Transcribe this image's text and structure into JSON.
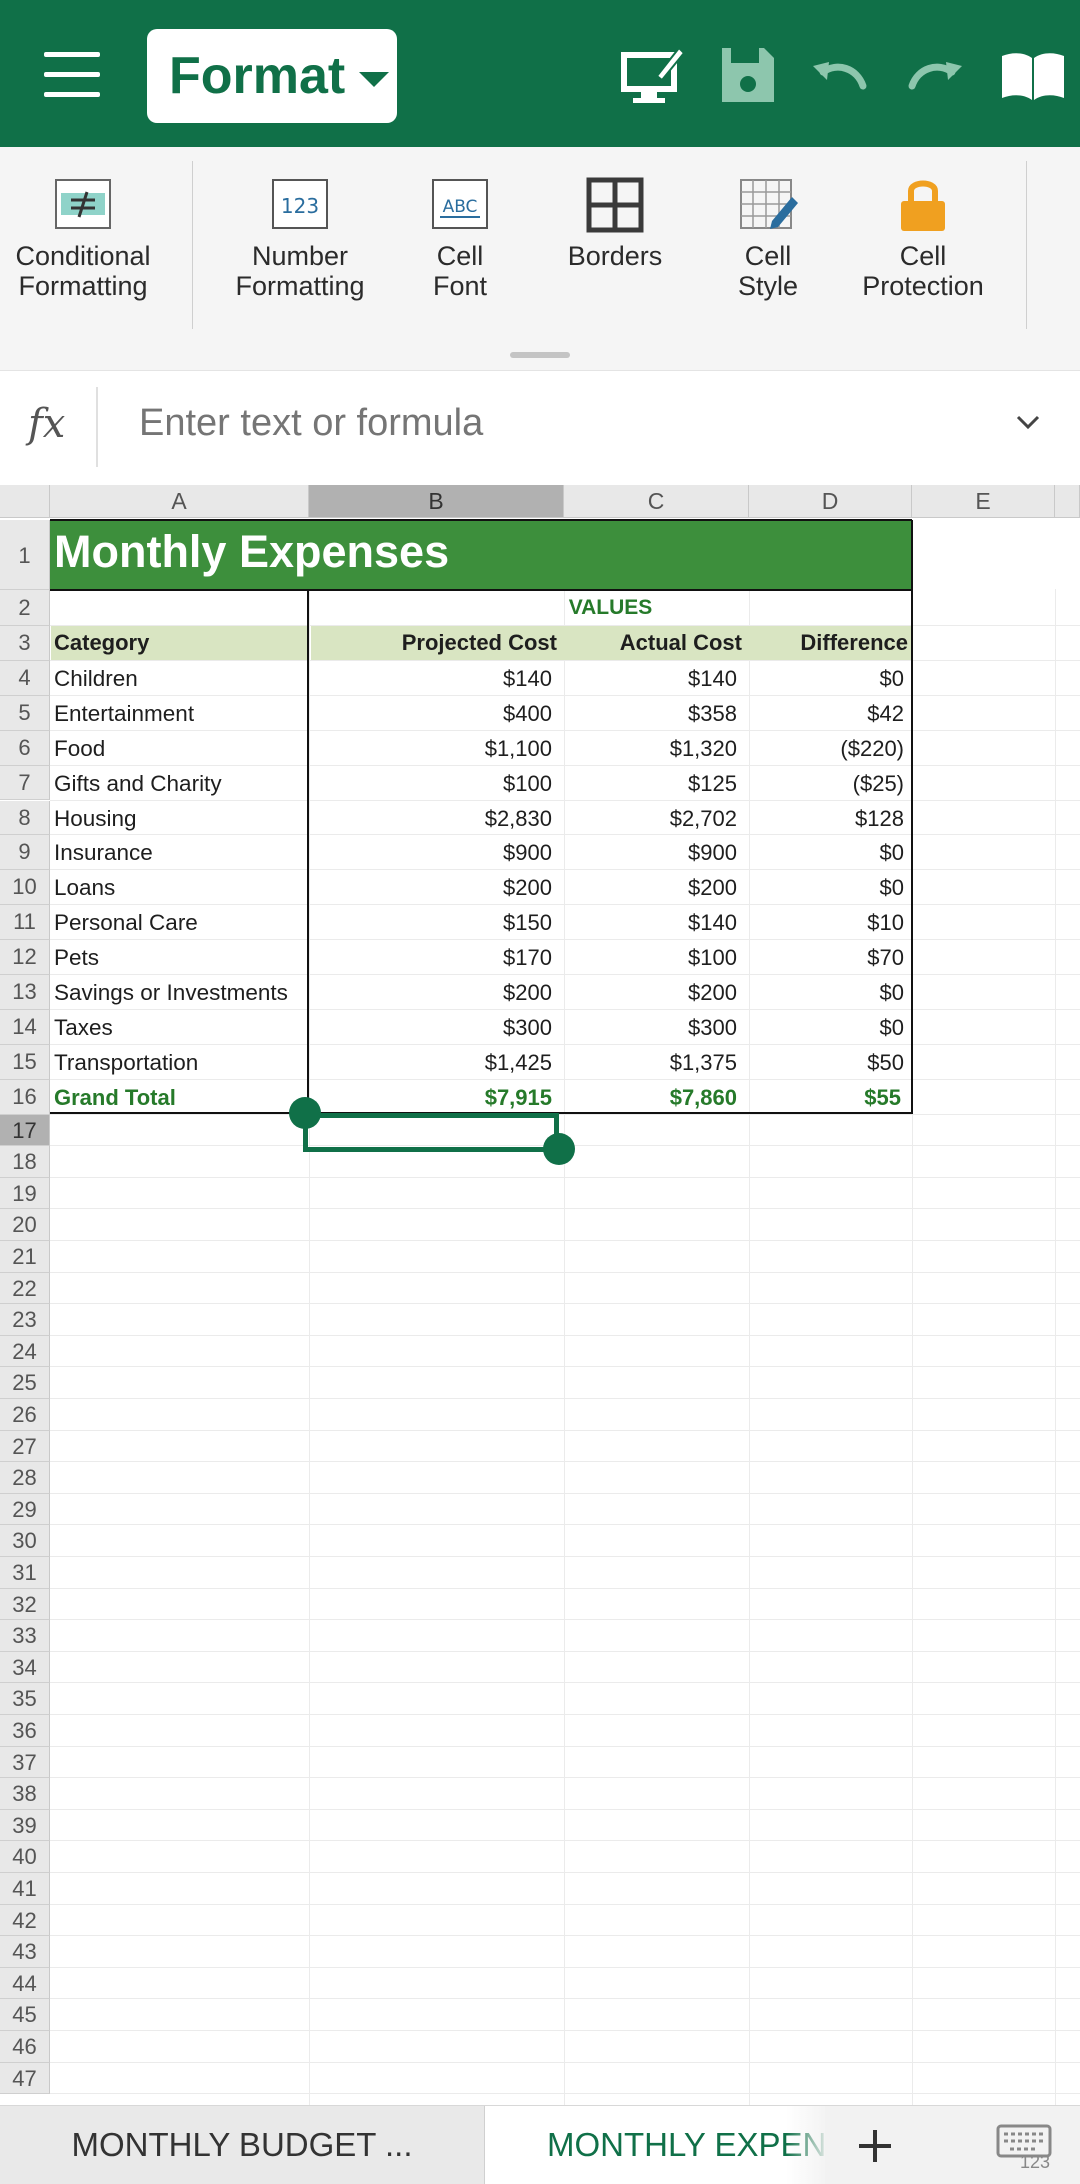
{
  "toolbar": {
    "mode_label": "Format",
    "icons": [
      "menu-icon",
      "presentation-icon",
      "save-icon",
      "undo-icon",
      "redo-icon",
      "read-mode-icon"
    ]
  },
  "ribbon": {
    "items": [
      {
        "line1": "Conditional",
        "line2": "Formatting",
        "icon": "conditional-formatting-icon"
      },
      {
        "line1": "Number",
        "line2": "Formatting",
        "icon": "number-formatting-icon"
      },
      {
        "line1": "Cell",
        "line2": "Font",
        "icon": "cell-font-icon"
      },
      {
        "line1": "Borders",
        "line2": "",
        "icon": "borders-icon"
      },
      {
        "line1": "Cell",
        "line2": "Style",
        "icon": "cell-style-icon"
      },
      {
        "line1": "Cell",
        "line2": "Protection",
        "icon": "cell-protection-icon"
      }
    ]
  },
  "formula_bar": {
    "fx_label": "fx",
    "placeholder": "Enter text or formula"
  },
  "grid": {
    "columns": [
      "A",
      "B",
      "C",
      "D",
      "E"
    ],
    "selected_column": "B",
    "selected_row": "17",
    "rows": [
      "1",
      "2",
      "3",
      "4",
      "5",
      "6",
      "7",
      "8",
      "9",
      "10",
      "11",
      "12",
      "13",
      "14",
      "15",
      "16",
      "17",
      "18",
      "19",
      "20",
      "21",
      "22",
      "23",
      "24",
      "25",
      "26",
      "27",
      "28",
      "29",
      "30",
      "31",
      "32",
      "33",
      "34",
      "35",
      "36",
      "37",
      "38",
      "39",
      "40",
      "41",
      "42",
      "43",
      "44",
      "45",
      "46",
      "47"
    ],
    "title": "Monthly Expenses",
    "values_label": "VALUES",
    "headers": [
      "Category",
      "Projected Cost",
      "Actual Cost",
      "Difference"
    ],
    "data": [
      [
        "Children",
        "$140",
        "$140",
        "$0"
      ],
      [
        "Entertainment",
        "$400",
        "$358",
        "$42"
      ],
      [
        "Food",
        "$1,100",
        "$1,320",
        "($220)"
      ],
      [
        "Gifts and Charity",
        "$100",
        "$125",
        "($25)"
      ],
      [
        "Housing",
        "$2,830",
        "$2,702",
        "$128"
      ],
      [
        "Insurance",
        "$900",
        "$900",
        "$0"
      ],
      [
        "Loans",
        "$200",
        "$200",
        "$0"
      ],
      [
        "Personal Care",
        "$150",
        "$140",
        "$10"
      ],
      [
        "Pets",
        "$170",
        "$100",
        "$70"
      ],
      [
        "Savings or Investments",
        "$200",
        "$200",
        "$0"
      ],
      [
        "Taxes",
        "$300",
        "$300",
        "$0"
      ],
      [
        "Transportation",
        "$1,425",
        "$1,375",
        "$50"
      ]
    ],
    "total": [
      "Grand Total",
      "$7,915",
      "$7,860",
      "$55"
    ]
  },
  "tabs": {
    "sheet1": "MONTHLY BUDGET ...",
    "sheet2": "MONTHLY EXPENSES",
    "add_icon": "add-sheet-icon",
    "keyboard_icon": "keyboard-123-icon",
    "keyboard_label": "123"
  },
  "colors": {
    "brand": "#107048",
    "title_fill": "#3d8f3c",
    "header_fill": "#d9e5c2",
    "accent_text": "#267a2a"
  }
}
